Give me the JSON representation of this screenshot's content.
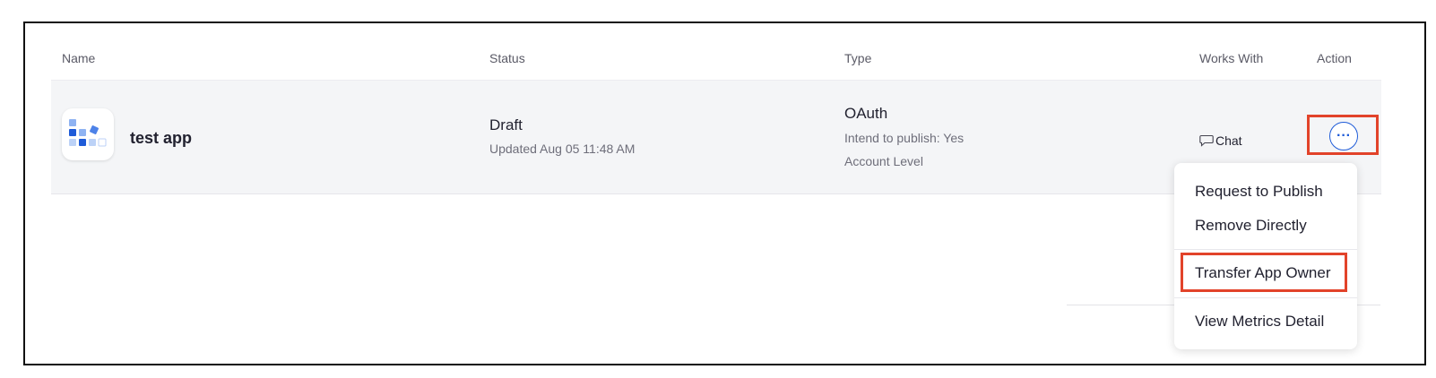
{
  "table": {
    "headers": {
      "name": "Name",
      "status": "Status",
      "type": "Type",
      "works_with": "Works With",
      "action": "Action"
    },
    "rows": [
      {
        "icon": "app-grid-icon",
        "name": "test app",
        "status": "Draft",
        "updated": "Updated Aug 05 11:48 AM",
        "type": "OAuth",
        "type_details": [
          "Intend to publish: Yes",
          "Account Level"
        ],
        "works_with": "Chat",
        "works_with_icon": "chat-bubble-icon",
        "action_icon": "more-horizontal-icon",
        "action_glyph": "···"
      }
    ]
  },
  "action_menu": {
    "items": [
      {
        "label": "Request to Publish"
      },
      {
        "label": "Remove Directly"
      },
      {
        "label": "Transfer App Owner",
        "highlighted": true
      },
      {
        "label": "View Metrics Detail"
      }
    ]
  },
  "colors": {
    "accent": "#1e5bd8",
    "highlight": "#e2432a",
    "row_background": "#f4f5f7",
    "text_primary": "#222230",
    "text_secondary": "#6e6e7a"
  }
}
